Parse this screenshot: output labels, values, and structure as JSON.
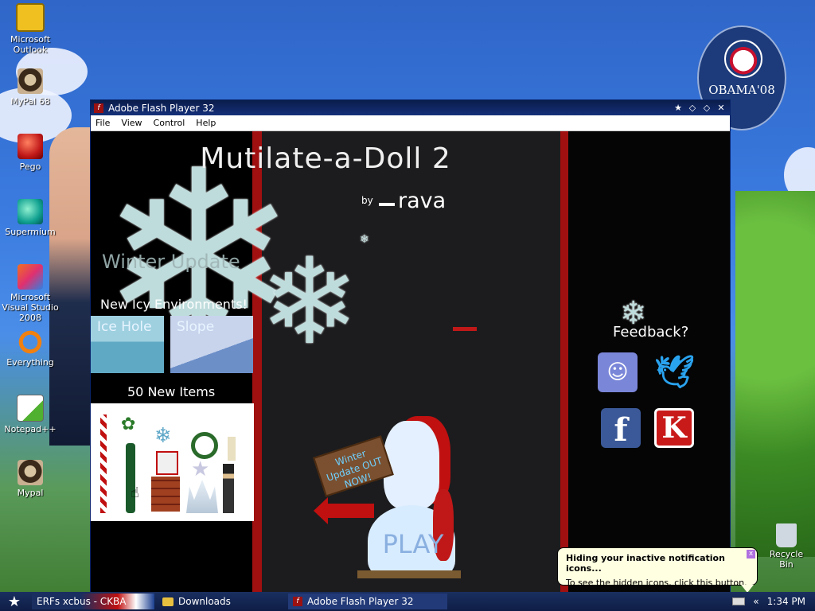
{
  "desktop": {
    "icons": [
      {
        "label": "Microsoft Outlook",
        "icon": "outlook-icon"
      },
      {
        "label": "MyPal 68",
        "icon": "mypal-icon"
      },
      {
        "label": "Pego",
        "icon": "pego-icon"
      },
      {
        "label": "Supermium",
        "icon": "supermium-icon"
      },
      {
        "label": "Microsoft Visual Studio 2008",
        "icon": "visual-studio-icon"
      },
      {
        "label": "Everything",
        "icon": "everything-icon"
      },
      {
        "label": "Notepad++",
        "icon": "notepadpp-icon"
      },
      {
        "label": "Mypal",
        "icon": "mypal-icon"
      }
    ],
    "recycle_bin": "Recycle Bin",
    "badge_text": "OBAMA'08"
  },
  "window": {
    "title": "Adobe Flash Player 32",
    "menu": [
      "File",
      "View",
      "Control",
      "Help"
    ]
  },
  "game": {
    "title": "Mutilate-a-Doll 2",
    "by": "by",
    "author": "rava",
    "winter_update": "Winter Update",
    "new_environments": "New Icy Environments!",
    "env_1": "Ice Hole",
    "env_2": "Slope",
    "new_items": "50 New Items",
    "sign_text": "Winter Update OUT NOW!",
    "play": "PLAY",
    "feedback": "Feedback?",
    "social": {
      "discord": "discord-icon",
      "twitter": "twitter-icon",
      "facebook": "f",
      "kongregate": "K"
    },
    "colors": {
      "accent_red": "#a01010",
      "ice": "#bfdcdc"
    }
  },
  "taskbar": {
    "items": [
      "ERFs xcbus - CKBA",
      "Downloads",
      "Adobe Flash Player 32"
    ],
    "clock": "1:34 PM"
  },
  "notification": {
    "title": "Hiding your inactive notification icons...",
    "text": "To see the hidden icons, click this button."
  }
}
